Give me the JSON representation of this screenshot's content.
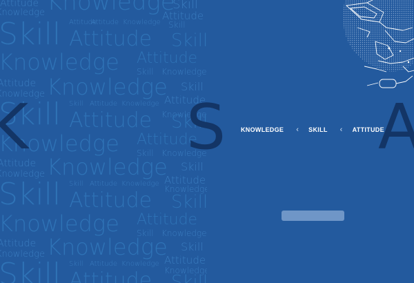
{
  "background_color": "#235a9e",
  "pattern_words": {
    "knowledge": "Knowledge",
    "skill": "Skill",
    "attitude": "Attitude"
  },
  "big_letters": {
    "k": "K",
    "s": "S",
    "a": "A"
  },
  "nav": {
    "items": [
      {
        "label": "KNOWLEDGE"
      },
      {
        "label": "SKILL"
      },
      {
        "label": "ATTITUDE"
      }
    ],
    "separator_icon": "chevron-left-icon"
  },
  "button_bar_color": "#6f96c7",
  "decorative_image": "line-art-halftone-sketch"
}
